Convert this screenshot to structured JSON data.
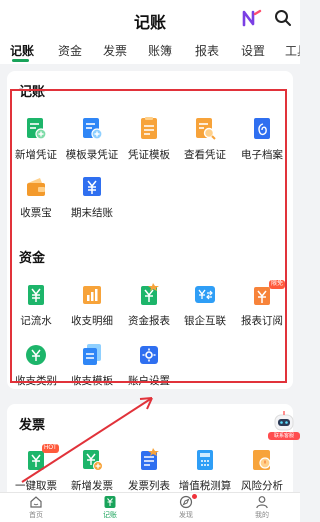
{
  "header": {
    "title": "记账",
    "brand_icon": "colorful-n-logo-icon",
    "search_icon": "search-icon"
  },
  "tabs": [
    {
      "label": "记账",
      "active": true
    },
    {
      "label": "资金"
    },
    {
      "label": "发票"
    },
    {
      "label": "账簿"
    },
    {
      "label": "报表"
    },
    {
      "label": "设置"
    },
    {
      "label": "工具"
    }
  ],
  "sections": {
    "bookkeeping": {
      "title": "记账",
      "items": [
        {
          "label": "新增凭证",
          "icon": "new-voucher-icon"
        },
        {
          "label": "模板录凭证",
          "icon": "template-voucher-icon"
        },
        {
          "label": "凭证模板",
          "icon": "voucher-template-icon"
        },
        {
          "label": "查看凭证",
          "icon": "view-voucher-icon"
        },
        {
          "label": "电子档案",
          "icon": "e-archive-icon"
        },
        {
          "label": "收票宝",
          "icon": "wallet-icon"
        },
        {
          "label": "期末结账",
          "icon": "period-close-icon"
        }
      ]
    },
    "funds": {
      "title": "资金",
      "items": [
        {
          "label": "记流水",
          "icon": "record-flow-icon"
        },
        {
          "label": "收支明细",
          "icon": "income-expense-chart-icon"
        },
        {
          "label": "资金报表",
          "icon": "fund-report-icon"
        },
        {
          "label": "银企互联",
          "icon": "bank-link-icon"
        },
        {
          "label": "报表订阅",
          "icon": "report-subscribe-icon",
          "badge": "限免"
        },
        {
          "label": "收支类别",
          "icon": "category-icon"
        },
        {
          "label": "收支模板",
          "icon": "income-template-icon"
        },
        {
          "label": "账户设置",
          "icon": "account-settings-icon"
        }
      ]
    },
    "invoice": {
      "title": "发票",
      "items": [
        {
          "label": "一键取票",
          "icon": "fetch-invoice-icon",
          "badge": "HOT"
        },
        {
          "label": "新增发票",
          "icon": "new-invoice-icon"
        },
        {
          "label": "发票列表",
          "icon": "invoice-list-icon"
        },
        {
          "label": "增值税测算",
          "icon": "vat-calculator-icon"
        },
        {
          "label": "风险分析",
          "icon": "risk-analysis-icon"
        }
      ]
    }
  },
  "float_helper": {
    "label": "联系客服",
    "icon": "robot-helper-icon"
  },
  "bottom_nav": [
    {
      "label": "首页",
      "icon": "home-icon"
    },
    {
      "label": "记账",
      "icon": "bookkeeping-icon",
      "active": true
    },
    {
      "label": "发现",
      "icon": "compass-icon",
      "dot": true
    },
    {
      "label": "我的",
      "icon": "profile-icon"
    }
  ],
  "colors": {
    "accent": "#19a35a",
    "highlight_box": "#e1323a",
    "blue": "#2f7bf6",
    "orange": "#f7a33a",
    "green": "#1db56a"
  }
}
